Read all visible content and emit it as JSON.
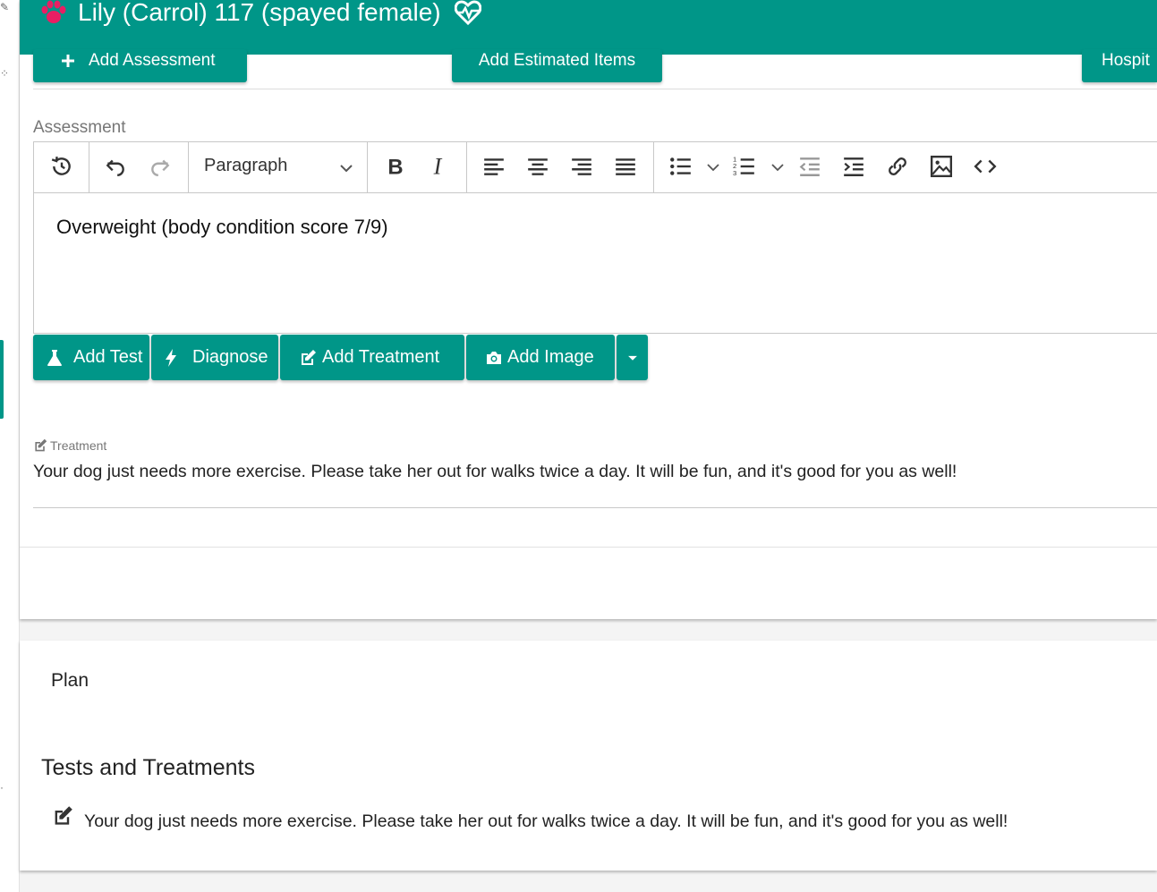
{
  "header": {
    "patient_title": "Lily (Carrol) 117 (spayed female)",
    "bg_color": "#009688",
    "paw_color": "#e91e63"
  },
  "top_actions": {
    "add_assessment": "Add Assessment",
    "add_estimated_items": "Add Estimated Items",
    "hospital": "Hospit"
  },
  "assessment": {
    "label": "Assessment",
    "block_format": "Paragraph",
    "content": "Overweight (body condition score 7/9)"
  },
  "toolbar_icons": [
    "history-icon",
    "undo-icon",
    "redo-icon",
    "bold-icon",
    "italic-icon",
    "align-left-icon",
    "align-center-icon",
    "align-right-icon",
    "align-justify-icon",
    "bullet-list-icon",
    "numbered-list-icon",
    "outdent-icon",
    "indent-icon",
    "link-icon",
    "image-icon",
    "source-code-icon"
  ],
  "actions": {
    "add_test": "Add Test",
    "diagnose": "Diagnose",
    "add_treatment": "Add Treatment",
    "add_image": "Add Image"
  },
  "treatment": {
    "label": "Treatment",
    "text": "Your dog just needs more exercise. Please take her out for walks twice a day. It will be fun, and it's good for you as well!"
  },
  "plan": {
    "label": "Plan",
    "tests_heading": "Tests and Treatments",
    "items": [
      {
        "text": "Your dog just needs more exercise. Please take her out for walks twice a day. It will be fun, and it's good for you as well!"
      }
    ]
  }
}
